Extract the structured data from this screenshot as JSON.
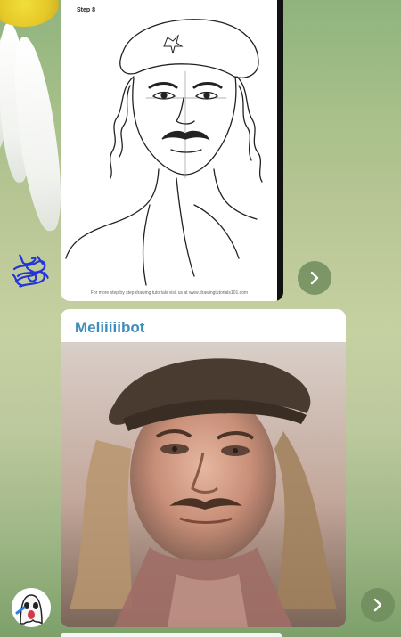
{
  "chat": {
    "messages": [
      {
        "type": "photo",
        "image_caption_step": "Step 8",
        "image_footer": "For more step by step drawing tutorials visit us at www.drawingtutorials101.com",
        "forward_icon": "chevron-right-icon"
      },
      {
        "type": "photo",
        "sender": "Meliiiiibot",
        "forward_icon": "chevron-right-icon"
      }
    ]
  },
  "colors": {
    "sender_name": "#3d8dbd",
    "bubble_bg": "#ffffff",
    "forward_button_bg": "#708c5e"
  }
}
